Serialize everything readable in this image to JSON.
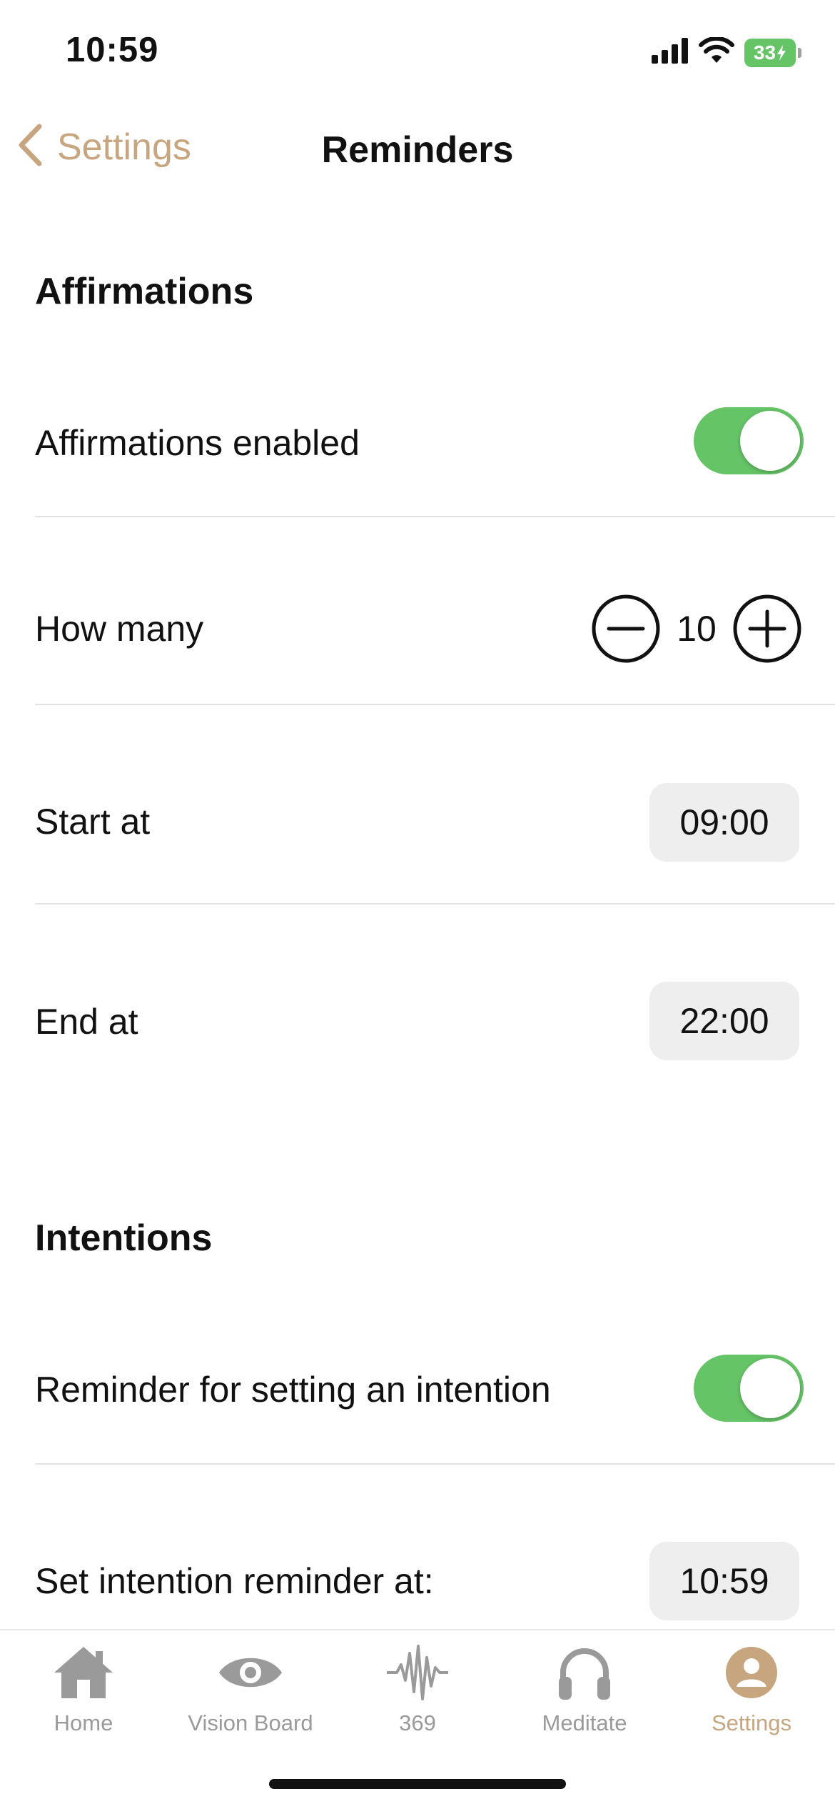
{
  "status_bar": {
    "time": "10:59",
    "battery": "33",
    "icons": [
      "signal-icon",
      "wifi-icon",
      "battery-icon"
    ]
  },
  "nav": {
    "back_label": "Settings",
    "title": "Reminders"
  },
  "affirmations": {
    "section_title": "Affirmations",
    "enabled_label": "Affirmations enabled",
    "enabled": true,
    "how_many_label": "How many",
    "how_many_value": "10",
    "start_label": "Start at",
    "start_value": "09:00",
    "end_label": "End at",
    "end_value": "22:00"
  },
  "intentions": {
    "section_title": "Intentions",
    "reminder_label": "Reminder for setting an intention",
    "reminder_enabled": true,
    "set_label": "Set intention reminder at:",
    "set_value": "10:59"
  },
  "tab_bar": {
    "tabs": [
      {
        "label": "Home",
        "icon": "home-icon",
        "active": false
      },
      {
        "label": "Vision Board",
        "icon": "eye-icon",
        "active": false
      },
      {
        "label": "369",
        "icon": "waveform-icon",
        "active": false
      },
      {
        "label": "Meditate",
        "icon": "headphones-icon",
        "active": false
      },
      {
        "label": "Settings",
        "icon": "person-icon",
        "active": true
      }
    ]
  },
  "colors": {
    "accent": "#c6a57f",
    "toggle_on": "#65c466",
    "tab_inactive": "#9a9a9a",
    "pill_bg": "#eeeeee"
  }
}
